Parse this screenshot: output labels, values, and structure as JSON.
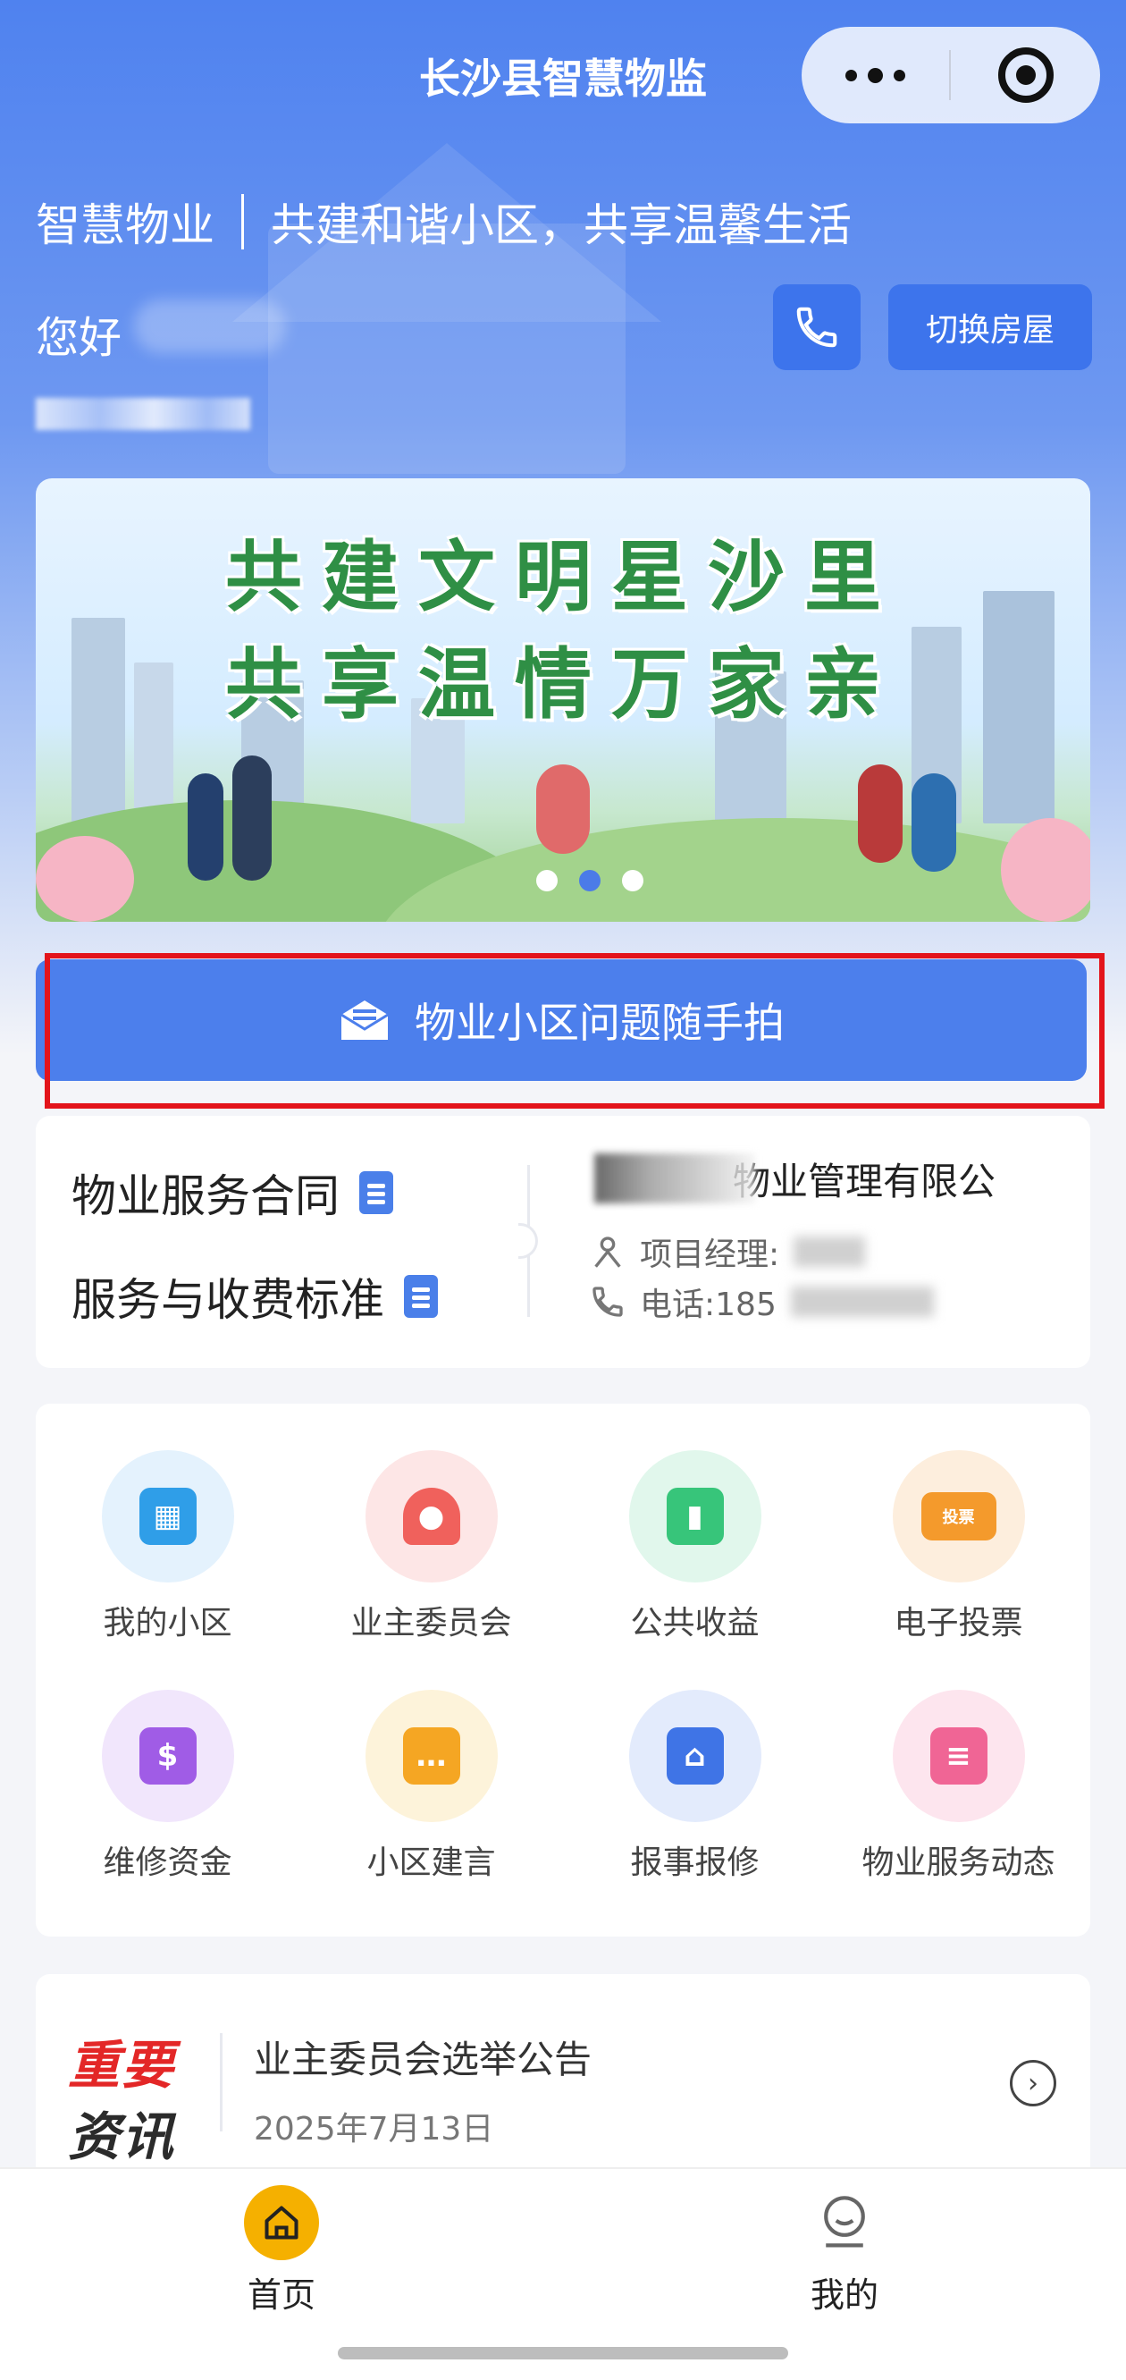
{
  "app": {
    "title": "长沙县智慧物监"
  },
  "header": {
    "slogan_left": "智慧物业",
    "slogan_right": "共建和谐小区，共享温馨生活",
    "greeting": "您好",
    "switch_house": "切换房屋"
  },
  "banner": {
    "line1": "共建文明星沙里",
    "line2": "共享温情万家亲",
    "page_count": 3,
    "active_page": 2
  },
  "report_button": "物业小区问题随手拍",
  "contract": {
    "items": [
      "物业服务合同",
      "服务与收费标准"
    ],
    "company_suffix": "物业管理有限公",
    "manager_label": "项目经理:",
    "phone_label": "电话:185"
  },
  "services": [
    {
      "label": "我的小区",
      "icon": "building-icon",
      "color": "#2f9ee8",
      "bg": "#e4f2fd"
    },
    {
      "label": "业主委员会",
      "icon": "people-icon",
      "color": "#f0615c",
      "bg": "#fde6e6"
    },
    {
      "label": "公共收益",
      "icon": "income-chart-icon",
      "color": "#37c57a",
      "bg": "#e1f7ec"
    },
    {
      "label": "电子投票",
      "icon": "vote-ticket-icon",
      "color": "#f49a2c",
      "bg": "#fdeedd"
    },
    {
      "label": "维修资金",
      "icon": "house-dollar-icon",
      "color": "#a05ce6",
      "bg": "#f1e6fc"
    },
    {
      "label": "小区建言",
      "icon": "chat-bubble-icon",
      "color": "#f5a623",
      "bg": "#fdf3da"
    },
    {
      "label": "报事报修",
      "icon": "wrench-house-icon",
      "color": "#3f74e6",
      "bg": "#e3ebfc"
    },
    {
      "label": "物业服务动态",
      "icon": "document-chat-icon",
      "color": "#f06595",
      "bg": "#fde5ee"
    }
  ],
  "ticket_icon_text": "投票",
  "news": {
    "badge_line1": "重要",
    "badge_line2": "资讯",
    "title": "业主委员会选举公告",
    "date": "2025年7月13日"
  },
  "tabbar": {
    "home": "首页",
    "mine": "我的"
  },
  "colors": {
    "primary": "#4c7fec",
    "highlight_frame": "#e3141b",
    "home_tab": "#f5b000"
  }
}
